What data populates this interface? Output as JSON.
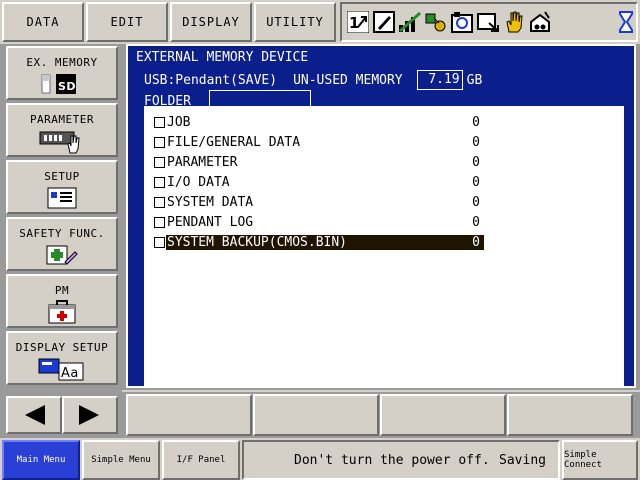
{
  "topbar": {
    "data_label": "DATA",
    "edit_label": "EDIT",
    "display_label": "DISPLAY",
    "utility_label": "UTILITY",
    "status_icons": [
      "coordinate-icon",
      "edit-mode-icon",
      "speed-bars-icon",
      "tool-interlock-icon",
      "cycle-icon",
      "play-mode-icon",
      "hand-icon",
      "servo-icon"
    ],
    "hourglass_icon": "hourglass-icon"
  },
  "sidebar": {
    "items": [
      {
        "label": "EX. MEMORY",
        "icon": "sd-card-icon"
      },
      {
        "label": "PARAMETER",
        "icon": "parameter-hand-icon"
      },
      {
        "label": "SETUP",
        "icon": "setup-icon"
      },
      {
        "label": "SAFETY FUNC.",
        "icon": "safety-icon"
      },
      {
        "label": "PM",
        "icon": "first-aid-icon"
      },
      {
        "label": "DISPLAY SETUP",
        "icon": "display-font-icon"
      }
    ],
    "font_icon_text": "Aa",
    "sd_icon_text": "SD"
  },
  "panel": {
    "title": "EXTERNAL MEMORY DEVICE",
    "usb_device": "USB:Pendant(SAVE)",
    "unused_label": "UN-USED MEMORY",
    "unused_value": "7.19",
    "unused_unit": "GB",
    "folder_label": "FOLDER",
    "folder_value": ""
  },
  "list": [
    {
      "label": "JOB",
      "count": "0"
    },
    {
      "label": "FILE/GENERAL DATA",
      "count": "0"
    },
    {
      "label": "PARAMETER",
      "count": "0"
    },
    {
      "label": "I/O DATA",
      "count": "0"
    },
    {
      "label": "SYSTEM DATA",
      "count": "0"
    },
    {
      "label": "PENDANT LOG",
      "count": "0"
    },
    {
      "label": "SYSTEM BACKUP(CMOS.BIN)",
      "count": "0",
      "selected": true
    }
  ],
  "bottombar": {
    "main_menu": "Main Menu",
    "simple_menu": "Simple Menu",
    "if_panel": "I/F Panel",
    "message": "Don't turn the power off.",
    "status": "Saving",
    "simple_connect": "Simple Connect"
  },
  "colors": {
    "panel_bg": "#0a1e8c",
    "selection_bg": "#1e1400",
    "main_menu_bg": "#2a3fd6",
    "chrome": "#d4d0c8"
  }
}
